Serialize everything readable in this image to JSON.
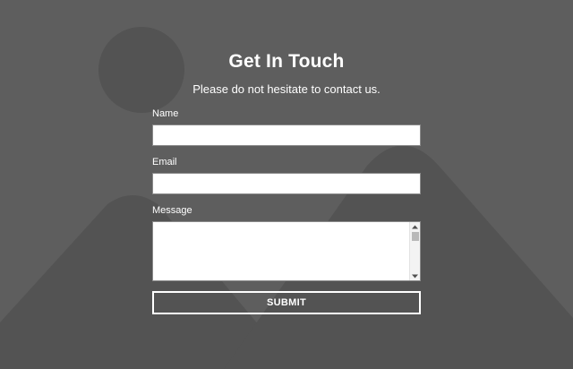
{
  "form": {
    "title": "Get In Touch",
    "subtitle": "Please do not hesitate to contact us.",
    "fields": {
      "name": {
        "label": "Name",
        "value": "",
        "placeholder": ""
      },
      "email": {
        "label": "Email",
        "value": "",
        "placeholder": ""
      },
      "message": {
        "label": "Message",
        "value": "",
        "placeholder": ""
      }
    },
    "submit_label": "SUBMIT"
  },
  "colors": {
    "background": "#5e5e5e",
    "placeholder_art": "#535353",
    "text": "#ffffff",
    "input_background": "#ffffff"
  },
  "icons": {
    "background": "placeholder-image-icon",
    "scroll_up": "scroll-up-arrow-icon",
    "scroll_down": "scroll-down-arrow-icon"
  }
}
